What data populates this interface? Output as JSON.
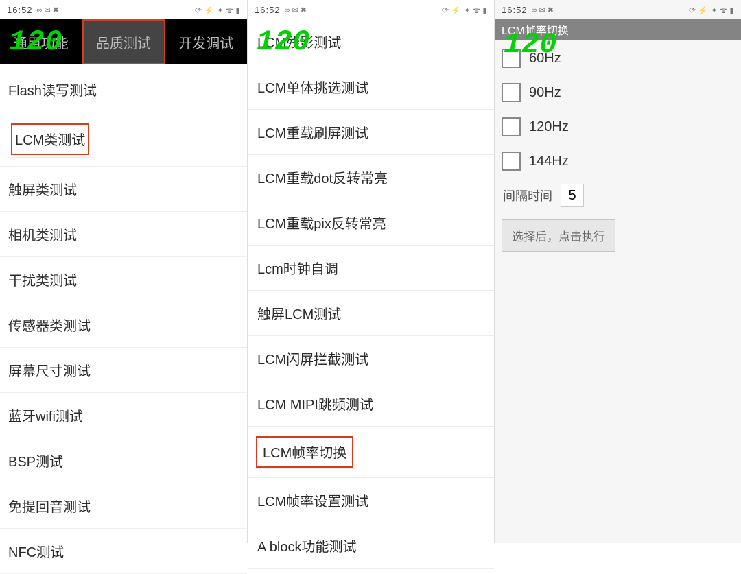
{
  "statusbar": {
    "time": "16:52",
    "left_icons": "∞ ✉ ✖",
    "right_icons": "⟳ ⚡ ✦ ᯤ ▮"
  },
  "fps": "120",
  "panel1": {
    "tabs": [
      "通用功能",
      "品质测试",
      "开发调试"
    ],
    "active_tab_index": 1,
    "items": [
      "Flash读写测试",
      "LCM类测试",
      "触屏类测试",
      "相机类测试",
      "干扰类测试",
      "传感器类测试",
      "屏幕尺寸测试",
      "蓝牙wifi测试",
      "BSP测试",
      "免提回音测试",
      "NFC测试"
    ],
    "highlight_index": 1
  },
  "panel2": {
    "items": [
      "LCM残影测试",
      "LCM单体挑选测试",
      "LCM重载刷屏测试",
      "LCM重载dot反转常亮",
      "LCM重载pix反转常亮",
      "Lcm时钟自调",
      "触屏LCM测试",
      "LCM闪屏拦截测试",
      "LCM MIPI跳频测试",
      "LCM帧率切换",
      "LCM帧率设置测试",
      "A block功能测试"
    ],
    "highlight_index": 9
  },
  "panel3": {
    "title": "LCM帧率切换",
    "options": [
      "60Hz",
      "90Hz",
      "120Hz",
      "144Hz"
    ],
    "interval_label": "间隔时间",
    "interval_value": "5",
    "run_label": "选择后，点击执行"
  }
}
